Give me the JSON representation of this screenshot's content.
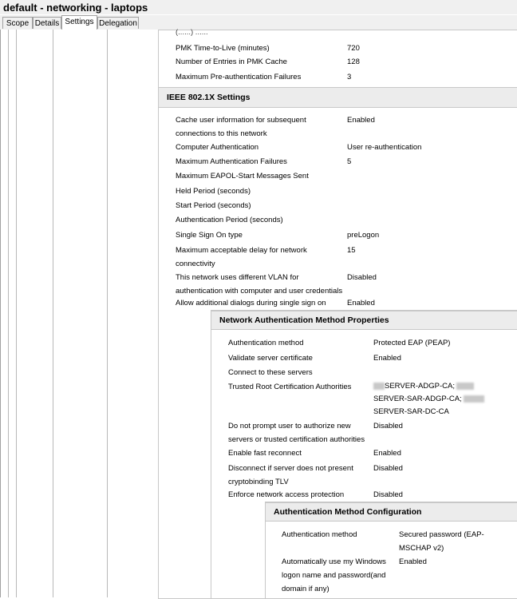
{
  "window": {
    "title": "default - networking - laptops"
  },
  "tabs": [
    {
      "label": "Scope"
    },
    {
      "label": "Details"
    },
    {
      "label": "Settings",
      "active": true
    },
    {
      "label": "Delegation"
    }
  ],
  "top_rows": {
    "partial": "(......) ......",
    "rows": [
      {
        "label": "PMK Time-to-Live (minutes)",
        "value": "720"
      },
      {
        "label": "Number of Entries in PMK Cache",
        "value": "128"
      },
      {
        "label": "Maximum Pre-authentication Failures",
        "value": "3"
      }
    ]
  },
  "ieee": {
    "header": "IEEE 802.1X Settings",
    "rows": [
      {
        "label": "Cache user information for subsequent connections to this network",
        "value": "Enabled"
      },
      {
        "label": "Computer Authentication",
        "value": "User re-authentication"
      },
      {
        "label": "Maximum Authentication Failures",
        "value": "5"
      },
      {
        "label": "Maximum EAPOL-Start Messages Sent",
        "value": ""
      },
      {
        "label": "Held Period (seconds)",
        "value": ""
      },
      {
        "label": "Start Period (seconds)",
        "value": ""
      },
      {
        "label": "Authentication Period (seconds)",
        "value": ""
      },
      {
        "label": "Single Sign On type",
        "value": "preLogon"
      },
      {
        "label": "Maximum acceptable delay for network connectivity",
        "value": "15"
      },
      {
        "label": "This network uses different VLAN for authentication with computer and user credentials",
        "value": "Disabled"
      },
      {
        "label": "Allow additional dialogs during single sign on",
        "value": "Enabled"
      }
    ]
  },
  "namp": {
    "header": "Network Authentication Method Properties",
    "rows": [
      {
        "label": "Authentication method",
        "value": "Protected EAP (PEAP)"
      },
      {
        "label": "Validate server certificate",
        "value": "Enabled"
      },
      {
        "label": "Connect to these servers",
        "value": ""
      },
      {
        "label": "Trusted Root Certification Authorities",
        "value_lines": [
          "SERVER-ADGP-CA;",
          "SERVER-SAR-ADGP-CA;",
          "SERVER-SAR-DC-CA"
        ]
      },
      {
        "label": "Do not prompt user to authorize new servers or trusted certification authorities",
        "value": "Disabled"
      },
      {
        "label": "Enable fast reconnect",
        "value": "Enabled"
      },
      {
        "label": "Disconnect if server does not present cryptobinding TLV",
        "value": "Disabled"
      },
      {
        "label": "Enforce network access protection",
        "value": "Disabled"
      }
    ]
  },
  "amc": {
    "header": "Authentication Method Configuration",
    "rows": [
      {
        "label": "Authentication method",
        "value": "Secured password (EAP-MSCHAP v2)"
      },
      {
        "label": "Automatically use my Windows logon name and password(and domain if any)",
        "value": "Enabled"
      }
    ]
  }
}
